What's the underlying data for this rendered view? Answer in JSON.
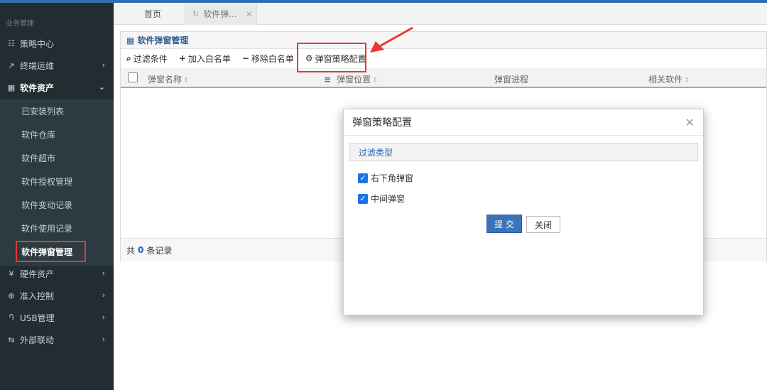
{
  "sidebar": {
    "section_title": "业务管理",
    "items": [
      {
        "label": "策略中心",
        "icon": "sliders-icon",
        "glyph": "☷",
        "arrow": ""
      },
      {
        "label": "终端运维",
        "icon": "external-link-icon",
        "glyph": "↗",
        "arrow": "›"
      },
      {
        "label": "软件资产",
        "icon": "grid-icon",
        "glyph": "▦",
        "arrow": "⌄"
      },
      {
        "label": "硬件资产",
        "icon": "yen-icon",
        "glyph": "¥",
        "arrow": "›"
      },
      {
        "label": "准入控制",
        "icon": "globe-icon",
        "glyph": "⊕",
        "arrow": "›"
      },
      {
        "label": "USB管理",
        "icon": "usb-icon",
        "glyph": "Ⴄ",
        "arrow": "›"
      },
      {
        "label": "外部联动",
        "icon": "exchange-icon",
        "glyph": "⇆",
        "arrow": "›"
      }
    ],
    "sub_items": [
      {
        "label": "已安装列表"
      },
      {
        "label": "软件仓库"
      },
      {
        "label": "软件超市"
      },
      {
        "label": "软件授权管理"
      },
      {
        "label": "软件变动记录"
      },
      {
        "label": "软件使用记录"
      },
      {
        "label": "软件弹窗管理"
      }
    ]
  },
  "tabs": {
    "home": "首页",
    "current": "软件弹...",
    "refresh_glyph": "↻",
    "close_glyph": "✕"
  },
  "panel": {
    "title": "软件弹窗管理",
    "title_glyph": "▦",
    "toolbar": {
      "filter": "过滤条件",
      "filter_glyph": "⌕",
      "add_whitelist": "加入白名单",
      "add_glyph": "+",
      "remove_whitelist": "移除白名单",
      "remove_glyph": "−",
      "popup_config": "弹窗策略配置",
      "config_glyph": "⚙"
    },
    "columns": {
      "name": "弹窗名称",
      "position": "弹窗位置",
      "position_glyph": "≡",
      "process": "弹窗进程",
      "software": "相关软件",
      "sort_glyph": "⇕"
    },
    "pager": {
      "prefix": "共",
      "count": "0",
      "suffix": "条记录"
    }
  },
  "modal": {
    "title": "弹窗策略配置",
    "close_glyph": "✕",
    "section": "过滤类型",
    "options": [
      {
        "label": "右下角弹窗",
        "checked": true
      },
      {
        "label": "中间弹窗",
        "checked": true
      }
    ],
    "check_glyph": "✓",
    "submit": "提 交",
    "close": "关闭"
  },
  "colors": {
    "sidebar_bg": "#222d32",
    "accent": "#3a73b8",
    "highlight": "#e53935"
  }
}
